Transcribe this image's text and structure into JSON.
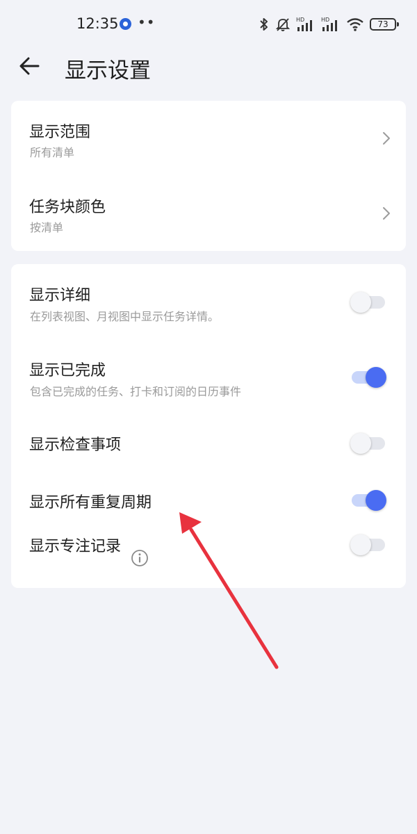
{
  "status_bar": {
    "time": "12:35",
    "more": "••",
    "battery": "73"
  },
  "header": {
    "title": "显示设置",
    "back_icon": "arrow-left-icon"
  },
  "card1": {
    "items": [
      {
        "title": "显示范围",
        "subtitle": "所有清单"
      },
      {
        "title": "任务块颜色",
        "subtitle": "按清单"
      }
    ]
  },
  "card2": {
    "items": [
      {
        "title": "显示详细",
        "subtitle": "在列表视图、月视图中显示任务详情。",
        "enabled": false
      },
      {
        "title": "显示已完成",
        "subtitle": "包含已完成的任务、打卡和订阅的日历事件",
        "enabled": true
      },
      {
        "title": "显示检查事项",
        "enabled": false
      },
      {
        "title": "显示所有重复周期",
        "enabled": true
      },
      {
        "title": "显示专注记录",
        "enabled": false,
        "icon": "info-icon"
      }
    ]
  },
  "colors": {
    "accent": "#4A6CF2",
    "annotation_arrow": "#E8323E",
    "background": "#F2F3F8"
  }
}
